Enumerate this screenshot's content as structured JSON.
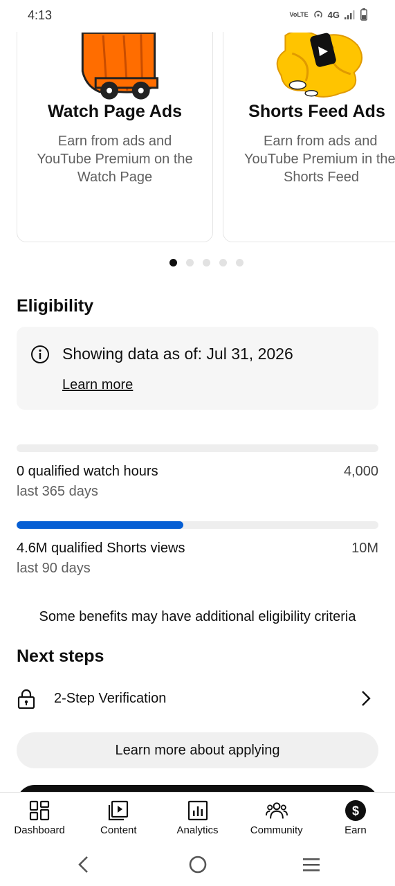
{
  "status_bar": {
    "time": "4:13",
    "network": "4G",
    "volte": "VoLTE"
  },
  "carousel": {
    "cards": [
      {
        "title": "Watch Page Ads",
        "desc_lines": [
          "Earn from ads and",
          "YouTube Premium on the",
          "Watch Page"
        ]
      },
      {
        "title": "Shorts Feed Ads",
        "desc_lines": [
          "Earn from ads and",
          "YouTube Premium in the",
          "Shorts Feed"
        ]
      }
    ],
    "page_count": 5,
    "active_index": 0
  },
  "eligibility": {
    "title": "Eligibility",
    "info_text": "Showing data as of: Jul 31, 2026",
    "learn_more": "Learn more",
    "metrics": [
      {
        "label": "0 qualified watch hours",
        "sub": "last 365 days",
        "target": "4,000",
        "progress": 0.0
      },
      {
        "label": "4.6M qualified Shorts views",
        "sub": "last 90 days",
        "target": "10M",
        "progress": 0.46
      }
    ],
    "note": "Some benefits may have additional eligibility criteria"
  },
  "next_steps": {
    "title": "Next steps",
    "items": [
      {
        "label": "2-Step Verification",
        "icon": "lock-icon"
      }
    ],
    "apply_button": "Learn more about applying"
  },
  "bottom_nav": {
    "items": [
      {
        "label": "Dashboard",
        "icon": "dashboard-icon"
      },
      {
        "label": "Content",
        "icon": "content-icon"
      },
      {
        "label": "Analytics",
        "icon": "analytics-icon"
      },
      {
        "label": "Community",
        "icon": "community-icon"
      },
      {
        "label": "Earn",
        "icon": "earn-icon",
        "active": true
      }
    ]
  },
  "colors": {
    "accent": "#065fd4",
    "text": "#0f0f0f",
    "secondary_text": "#606060",
    "illustration_orange": "#ff6d00",
    "illustration_yellow": "#ffc400"
  }
}
